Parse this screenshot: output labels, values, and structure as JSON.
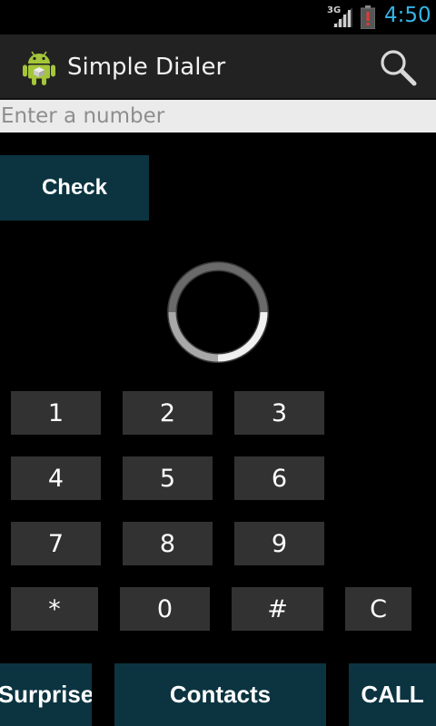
{
  "status_bar": {
    "network": "3G",
    "time": "4:50",
    "colors": {
      "time": "#33b5e5",
      "battery_alert": "#d32f2f"
    },
    "icons": [
      "signal-icon",
      "battery-alert-icon"
    ]
  },
  "action_bar": {
    "title": "Simple Dialer",
    "icons": [
      "android-app-icon",
      "search-icon"
    ]
  },
  "number_input": {
    "placeholder": "Enter a number",
    "value": ""
  },
  "check_button": {
    "label": "Check"
  },
  "keypad": {
    "keys": [
      "1",
      "2",
      "3",
      "4",
      "5",
      "6",
      "7",
      "8",
      "9",
      "*",
      "0",
      "#",
      "C"
    ]
  },
  "bottom_bar": {
    "surprise_label": "Surprise",
    "contacts_label": "Contacts",
    "call_label": "CALL"
  },
  "colors": {
    "button_bg": "#0b3440",
    "key_bg": "#323232",
    "action_bar_bg": "#222222",
    "input_bg": "#ebebeb"
  }
}
